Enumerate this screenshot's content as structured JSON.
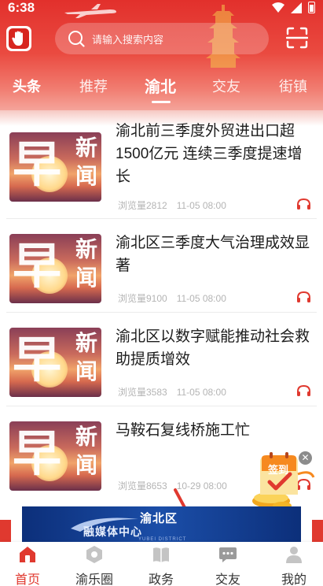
{
  "status_bar": {
    "time": "6:38"
  },
  "header": {
    "search_placeholder": "请输入搜索内容",
    "tabs": [
      {
        "label": "头条",
        "active": false
      },
      {
        "label": "推荐",
        "active": false
      },
      {
        "label": "渝北",
        "active": true
      },
      {
        "label": "交友",
        "active": false
      },
      {
        "label": "街镇",
        "active": false
      }
    ]
  },
  "news": [
    {
      "title": "渝北前三季度外贸进出口超1500亿元 连续三季度提速增长",
      "views": "浏览量2812",
      "date": "11-05 08:00",
      "thumb_big": "早",
      "thumb_small_1": "新",
      "thumb_small_2": "闻"
    },
    {
      "title": "渝北区三季度大气治理成效显著",
      "views": "浏览量9100",
      "date": "11-05 08:00",
      "thumb_big": "早",
      "thumb_small_1": "新",
      "thumb_small_2": "闻"
    },
    {
      "title": "渝北区以数字赋能推动社会救助提质增效",
      "views": "浏览量3583",
      "date": "11-05 08:00",
      "thumb_big": "早",
      "thumb_small_1": "新",
      "thumb_small_2": "闻"
    },
    {
      "title": "马鞍石复线桥施工忙",
      "views": "浏览量8653",
      "date": "10-29 08:00",
      "thumb_big": "早",
      "thumb_small_1": "新",
      "thumb_small_2": "闻"
    }
  ],
  "sign_in": {
    "label": "签到",
    "close": "✕"
  },
  "banner": {
    "title": "渝北区",
    "subtitle": "融媒体中心",
    "tiny": "YUBEI DISTRICT"
  },
  "bottom_nav": [
    {
      "label": "首页",
      "active": true,
      "icon": "home-icon"
    },
    {
      "label": "渝乐圈",
      "active": false,
      "icon": "circle-icon"
    },
    {
      "label": "政务",
      "active": false,
      "icon": "government-icon"
    },
    {
      "label": "交友",
      "active": false,
      "icon": "chat-icon"
    },
    {
      "label": "我的",
      "active": false,
      "icon": "profile-icon"
    }
  ],
  "colors": {
    "brand_red": "#e0392f",
    "header_top": "#e2302c",
    "text_dark": "#1c1c1c",
    "text_meta": "#b4b4b4"
  }
}
